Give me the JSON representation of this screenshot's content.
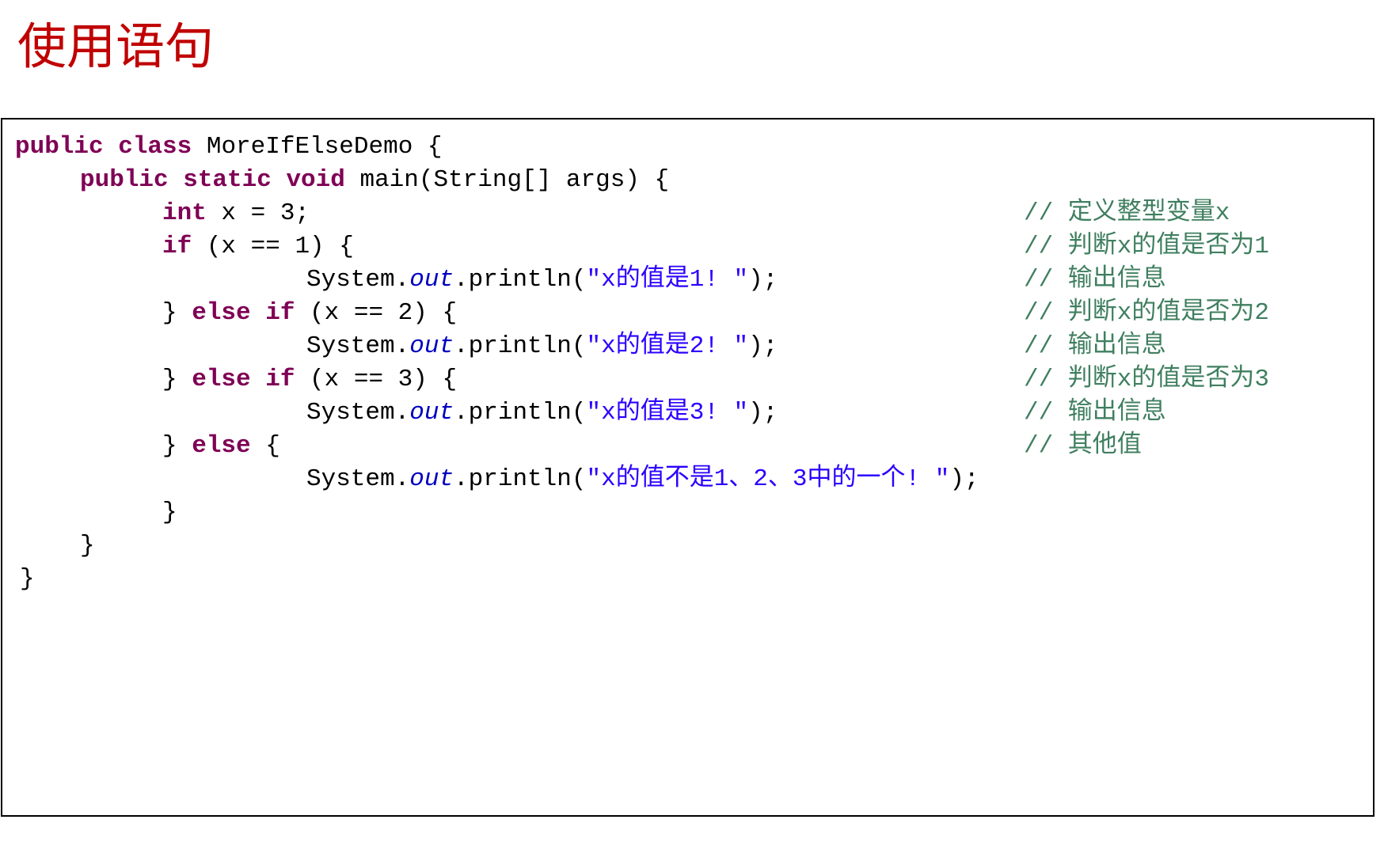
{
  "slide": {
    "title": "使用语句"
  },
  "code": {
    "lines": [
      {
        "kw1": "public class",
        "t1": " MoreIfElseDemo {"
      },
      {
        "kw1": "public static void",
        "t1": " main(String[] args) {"
      },
      {
        "kw1": "int",
        "t1": " x = 3;",
        "comment": "// 定义整型变量x"
      },
      {
        "kw1": "if",
        "t1": " (x == 1) {",
        "comment": "// 判断x的值是否为1"
      },
      {
        "t1": "System.",
        "fld": "out",
        "t2": ".println(",
        "str": "\"x的值是1! \"",
        "t3": ");",
        "comment": "// 输出信息"
      },
      {
        "t1": "} ",
        "kw1": "else if",
        "t2": " (x == 2) {",
        "comment": "// 判断x的值是否为2"
      },
      {
        "t1": "System.",
        "fld": "out",
        "t2": ".println(",
        "str": "\"x的值是2! \"",
        "t3": ");",
        "comment": "// 输出信息"
      },
      {
        "t1": "} ",
        "kw1": "else if",
        "t2": " (x == 3) {",
        "comment": "// 判断x的值是否为3"
      },
      {
        "t1": "System.",
        "fld": "out",
        "t2": ".println(",
        "str": "\"x的值是3! \"",
        "t3": ");",
        "comment": "// 输出信息"
      },
      {
        "t1": "} ",
        "kw1": "else",
        "t2": " {",
        "comment": "// 其他值"
      },
      {
        "t1": "System.",
        "fld": "out",
        "t2": ".println(",
        "str": "\"x的值不是1、2、3中的一个! \"",
        "t3": ");"
      },
      {
        "t1": "}"
      },
      {
        "t1": "}"
      },
      {
        "t1": "}"
      }
    ]
  },
  "colors": {
    "title": "#c00000",
    "keyword": "#7f0055",
    "string": "#2a00ff",
    "field": "#0000c0",
    "comment": "#3f7f5f",
    "border": "#000000"
  }
}
